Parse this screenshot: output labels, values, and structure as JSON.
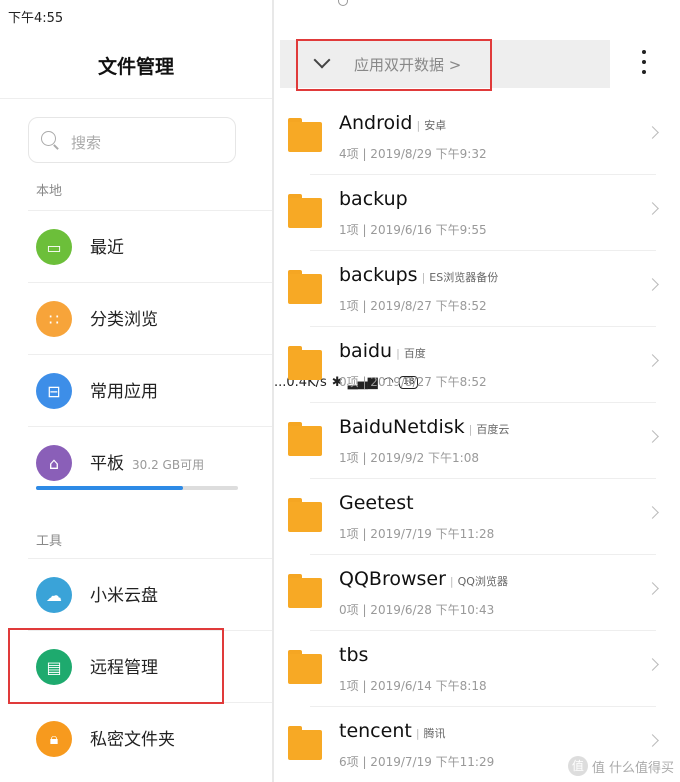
{
  "status_bar": {
    "time": "下午4:55",
    "speed": "...0.4K/s",
    "battery": "18"
  },
  "left_panel": {
    "title": "文件管理",
    "search_placeholder": "搜索",
    "section_local": "本地",
    "section_tools": "工具",
    "items": [
      {
        "label": "最近",
        "color": "#6cbf3a"
      },
      {
        "label": "分类浏览",
        "color": "#f7a43a"
      },
      {
        "label": "常用应用",
        "color": "#3d8ee8"
      },
      {
        "label": "平板",
        "sub": "30.2 GB可用",
        "color": "#8a5fb8"
      },
      {
        "label": "小米云盘",
        "color": "#3aa3d8"
      },
      {
        "label": "远程管理",
        "color": "#1eaa6e"
      },
      {
        "label": "私密文件夹",
        "color": "#f79a1e"
      }
    ],
    "storage_used_fraction": 0.73
  },
  "right_panel": {
    "path_label": "应用双开数据 >",
    "folders": [
      {
        "name": "Android",
        "alias": "安卓",
        "meta": "4项 | 2019/8/29 下午9:32"
      },
      {
        "name": "backup",
        "alias": "",
        "meta": "1项 | 2019/6/16 下午9:55"
      },
      {
        "name": "backups",
        "alias": "ES浏览器备份",
        "meta": "1项 | 2019/8/27 下午8:52"
      },
      {
        "name": "baidu",
        "alias": "百度",
        "meta": "0项 | 2019/8/27 下午8:52"
      },
      {
        "name": "BaiduNetdisk",
        "alias": "百度云",
        "meta": "1项 | 2019/9/2 下午1:08"
      },
      {
        "name": "Geetest",
        "alias": "",
        "meta": "1项 | 2019/7/19 下午11:28"
      },
      {
        "name": "QQBrowser",
        "alias": "QQ浏览器",
        "meta": "0项 | 2019/6/28 下午10:43"
      },
      {
        "name": "tbs",
        "alias": "",
        "meta": "1项 | 2019/6/14 下午8:18"
      },
      {
        "name": "tencent",
        "alias": "腾讯",
        "meta": "6项 | 2019/7/19 下午11:29"
      }
    ]
  },
  "watermark": "值 什么值得买"
}
